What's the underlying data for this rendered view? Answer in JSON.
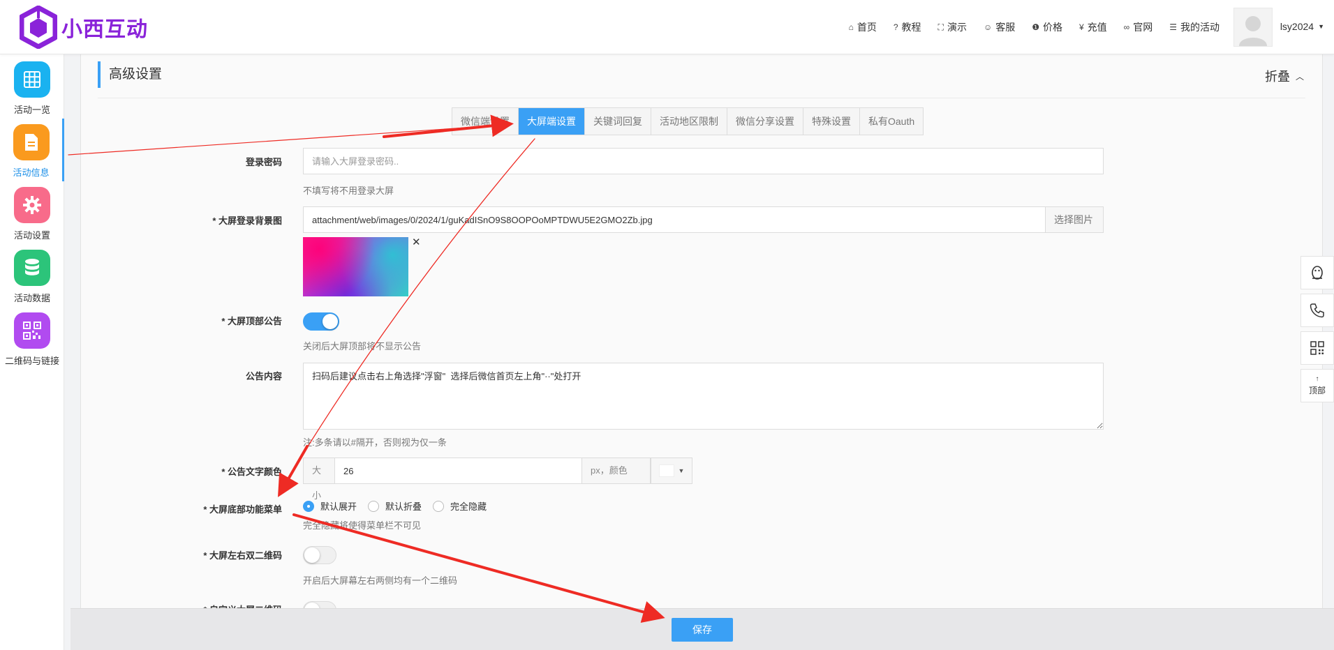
{
  "brand": {
    "name": "小西互动",
    "color": "#8a23d9"
  },
  "nav": [
    {
      "label": "首页",
      "icon": "home-icon",
      "glyph": "⌂"
    },
    {
      "label": "教程",
      "icon": "help-circle-icon",
      "glyph": "?"
    },
    {
      "label": "演示",
      "icon": "fullscreen-icon",
      "glyph": "⛶"
    },
    {
      "label": "客服",
      "icon": "smile-icon",
      "glyph": "☺"
    },
    {
      "label": "价格",
      "icon": "info-icon",
      "glyph": "❶"
    },
    {
      "label": "充值",
      "icon": "yen-icon",
      "glyph": "¥"
    },
    {
      "label": "官网",
      "icon": "link-icon",
      "glyph": "∞"
    },
    {
      "label": "我的活动",
      "icon": "list-icon",
      "glyph": "☰"
    }
  ],
  "user": {
    "name": "lsy2024"
  },
  "sidebar": {
    "items": [
      {
        "label": "活动一览",
        "color": "#1ab2f0"
      },
      {
        "label": "活动信息",
        "color": "#fa9a1e"
      },
      {
        "label": "活动设置",
        "color": "#f86b8a"
      },
      {
        "label": "活动数据",
        "color": "#2cc47a"
      },
      {
        "label": "二维码与链接",
        "color": "#b14bf0"
      }
    ]
  },
  "section": {
    "title": "高级设置",
    "fold_label": "折叠"
  },
  "tabs": [
    "微信端设置",
    "大屏端设置",
    "关键词回复",
    "活动地区限制",
    "微信分享设置",
    "特殊设置",
    "私有Oauth"
  ],
  "form": {
    "login_password": {
      "label": "登录密码",
      "placeholder": "请输入大屏登录密码..",
      "help": "不填写将不用登录大屏"
    },
    "login_bg": {
      "label": "* 大屏登录背景图",
      "value": "attachment/web/images/0/2024/1/guKadISnO9S8OOPOoMPTDWU5E2GMO2Zb.jpg",
      "button": "选择图片"
    },
    "top_notice": {
      "label": "* 大屏顶部公告",
      "help": "关闭后大屏顶部将不显示公告"
    },
    "notice_content": {
      "label": "公告内容",
      "value": "扫码后建议点击右上角选择\"浮窗\"  选择后微信首页左上角\"··\"处打开",
      "help": "注:多条请以#隔开，否则视为仅一条"
    },
    "notice_color": {
      "label": "* 公告文字颜色",
      "size_label": "大小",
      "size_value": "26",
      "unit_label": "px，颜色",
      "swatch": "#ffffff"
    },
    "bottom_menu": {
      "label": "* 大屏底部功能菜单",
      "options": [
        "默认展开",
        "默认折叠",
        "完全隐藏"
      ],
      "help": "完全隐藏将使得菜单栏不可见"
    },
    "dual_qr": {
      "label": "* 大屏左右双二维码",
      "help": "开启后大屏幕左右两侧均有一个二维码"
    },
    "custom_qr": {
      "label": "* 自定义大屏二维码"
    }
  },
  "footer": {
    "save_label": "保存"
  },
  "right_tools": {
    "top_label": "顶部"
  },
  "annotation_color": "#ee2b24"
}
